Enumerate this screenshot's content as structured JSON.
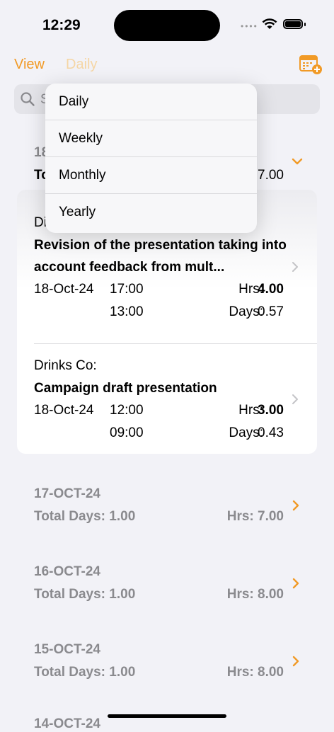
{
  "status": {
    "time": "12:29",
    "dots": "••••"
  },
  "nav": {
    "view_label": "View",
    "period_label": "Daily"
  },
  "search": {
    "placeholder": "S"
  },
  "expanded_group": {
    "date": "18",
    "totals": "Tot",
    "hrs": "7.00"
  },
  "entries": [
    {
      "client": "Di",
      "title": "Revision of the presentation taking into account feedback from mult...",
      "date": "18-Oct-24",
      "end": "17:00",
      "start": "13:00",
      "hrs_label": "Hrs:",
      "hrs": "4.00",
      "days_label": "Days:",
      "days": "0.57"
    },
    {
      "client": "Drinks Co:",
      "title": "Campaign draft presentation",
      "date": "18-Oct-24",
      "end": "12:00",
      "start": "09:00",
      "hrs_label": "Hrs:",
      "hrs": "3.00",
      "days_label": "Days:",
      "days": "0.43"
    }
  ],
  "groups": [
    {
      "date": "17-OCT-24",
      "days": "Total Days: 1.00",
      "hrs": "Hrs: 7.00"
    },
    {
      "date": "16-OCT-24",
      "days": "Total Days: 1.00",
      "hrs": "Hrs: 8.00"
    },
    {
      "date": "15-OCT-24",
      "days": "Total Days: 1.00",
      "hrs": "Hrs: 8.00"
    }
  ],
  "peek_date": "14-OCT-24",
  "menu": {
    "items": [
      "Daily",
      "Weekly",
      "Monthly",
      "Yearly"
    ]
  },
  "colors": {
    "accent": "#f19a26",
    "secondary_text": "#8a8a8e",
    "background": "#f2f2f7"
  }
}
